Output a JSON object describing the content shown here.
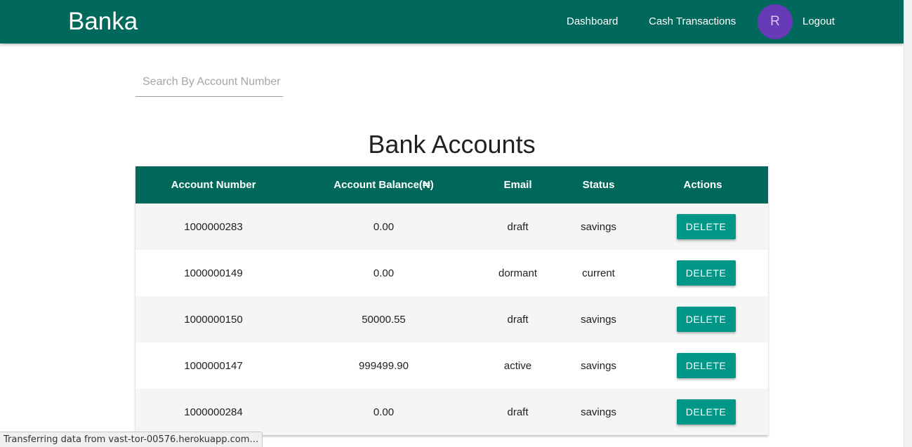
{
  "header": {
    "brand": "Banka",
    "nav": {
      "dashboard": "Dashboard",
      "cash_transactions": "Cash Transactions",
      "logout": "Logout"
    },
    "avatar_initial": "R",
    "colors": {
      "bar": "#00695c",
      "avatar": "#673ab7"
    }
  },
  "search": {
    "placeholder": "Search By Account Number",
    "value": ""
  },
  "main": {
    "title": "Bank Accounts",
    "table": {
      "columns": [
        "Account Number",
        "Account Balance(₦)",
        "Email",
        "Status",
        "Actions"
      ],
      "rows": [
        {
          "account_number": "1000000283",
          "balance": "0.00",
          "email": "draft",
          "status": "savings",
          "action": "DELETE"
        },
        {
          "account_number": "1000000149",
          "balance": "0.00",
          "email": "dormant",
          "status": "current",
          "action": "DELETE"
        },
        {
          "account_number": "1000000150",
          "balance": "50000.55",
          "email": "draft",
          "status": "savings",
          "action": "DELETE"
        },
        {
          "account_number": "1000000147",
          "balance": "999499.90",
          "email": "active",
          "status": "savings",
          "action": "DELETE"
        },
        {
          "account_number": "1000000284",
          "balance": "0.00",
          "email": "draft",
          "status": "savings",
          "action": "DELETE"
        }
      ]
    },
    "colors": {
      "header": "#00695c",
      "button": "#009688"
    }
  },
  "browser_status": "Transferring data from vast-tor-00576.herokuapp.com…"
}
